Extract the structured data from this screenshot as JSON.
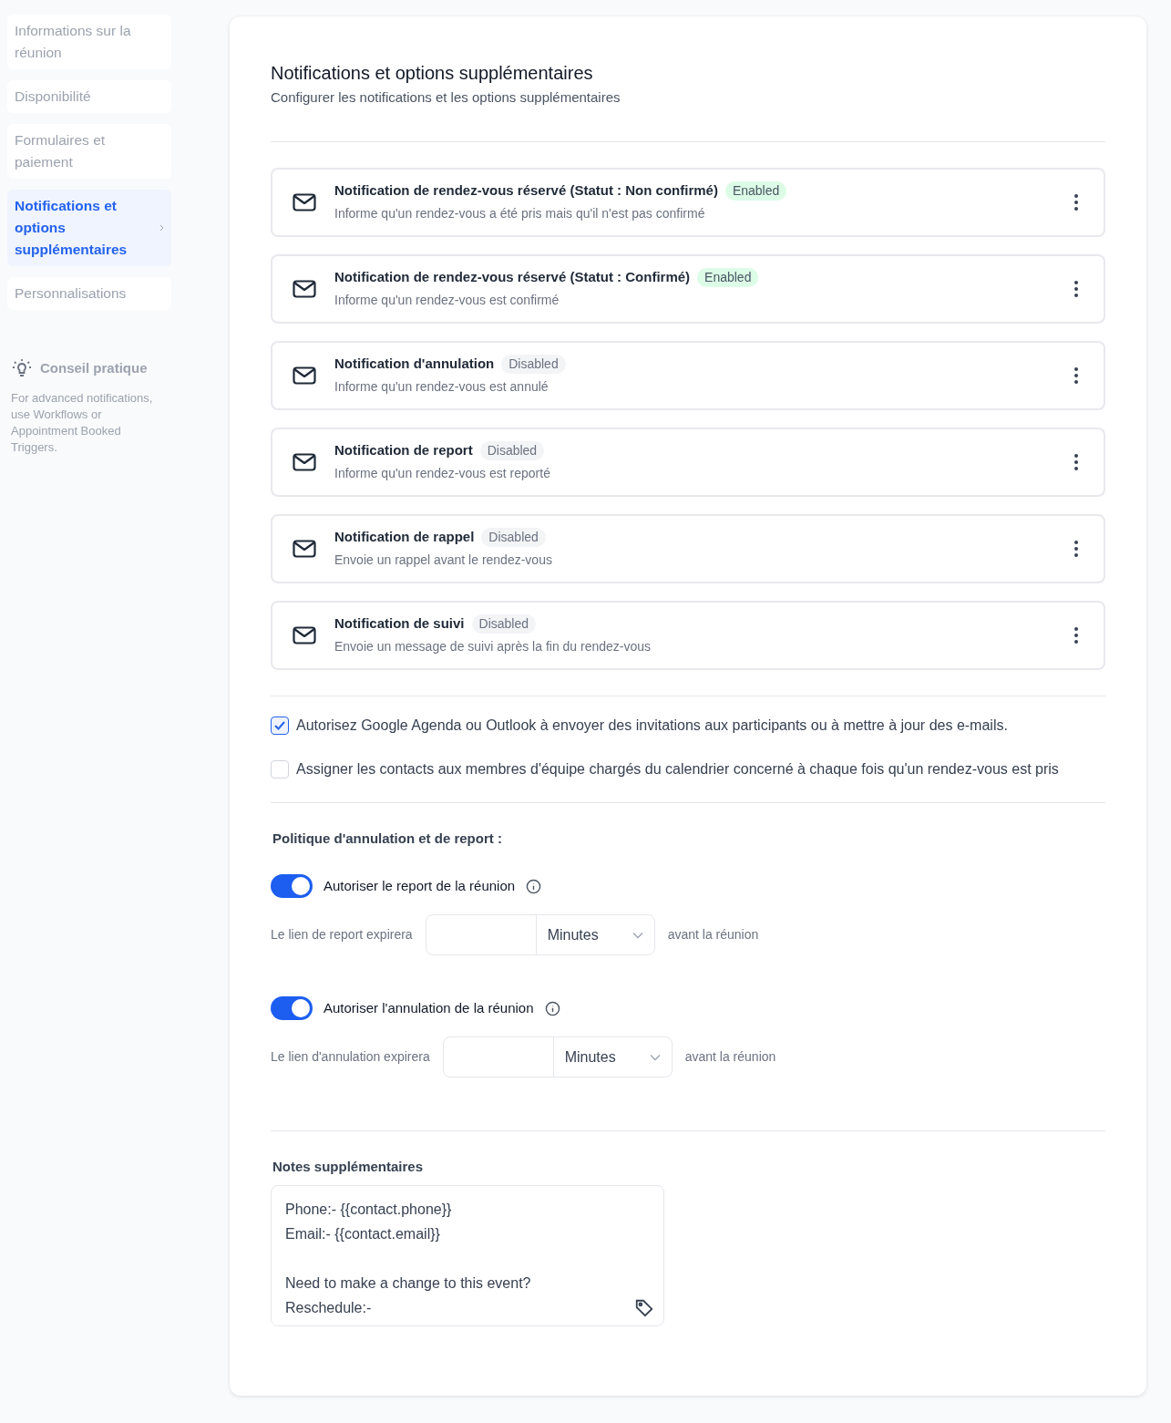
{
  "sidebar": {
    "items": [
      {
        "label": "Informations sur la réunion",
        "selected": false
      },
      {
        "label": "Disponibilité",
        "selected": false
      },
      {
        "label": "Formulaires et paiement",
        "selected": false
      },
      {
        "label": "Notifications et options supplémentaires",
        "selected": true
      },
      {
        "label": "Personnalisations",
        "selected": false
      }
    ],
    "tip": {
      "title": "Conseil pratique",
      "text": "For advanced notifications, use Workflows or Appointment Booked Triggers."
    }
  },
  "header": {
    "title": "Notifications et options supplémentaires",
    "subtitle": "Configurer les notifications et les options supplémentaires"
  },
  "notifications": [
    {
      "title": "Notification de rendez-vous réservé (Statut : Non confirmé)",
      "status": "Enabled",
      "enabled": true,
      "description": "Informe qu'un rendez-vous a été pris mais qu'il n'est pas confirmé"
    },
    {
      "title": "Notification de rendez-vous réservé (Statut : Confirmé)",
      "status": "Enabled",
      "enabled": true,
      "description": "Informe qu'un rendez-vous est confirmé"
    },
    {
      "title": "Notification d'annulation",
      "status": "Disabled",
      "enabled": false,
      "description": "Informe qu'un rendez-vous est annulé"
    },
    {
      "title": "Notification de report",
      "status": "Disabled",
      "enabled": false,
      "description": "Informe qu'un rendez-vous est reporté"
    },
    {
      "title": "Notification de rappel",
      "status": "Disabled",
      "enabled": false,
      "description": "Envoie un rappel avant le rendez-vous"
    },
    {
      "title": "Notification de suivi",
      "status": "Disabled",
      "enabled": false,
      "description": "Envoie un message de suivi après la fin du rendez-vous"
    }
  ],
  "checkboxes": [
    {
      "label": "Autorisez Google Agenda ou Outlook à envoyer des invitations aux participants ou à mettre à jour des e-mails.",
      "checked": true
    },
    {
      "label": "Assigner les contacts aux membres d'équipe chargés du calendrier concerné à chaque fois qu'un rendez-vous est pris",
      "checked": false
    }
  ],
  "policy": {
    "title": "Politique d'annulation et de report :",
    "options": [
      {
        "label": "Autoriser le report de la réunion",
        "on": true,
        "expiry_label": "Le lien de report expirera",
        "unit": "Minutes",
        "suffix": "avant la réunion"
      },
      {
        "label": "Autoriser l'annulation de la réunion",
        "on": true,
        "expiry_label": "Le lien d'annulation expirera",
        "unit": "Minutes",
        "suffix": "avant la réunion"
      }
    ]
  },
  "notes": {
    "title": "Notes supplémentaires",
    "paragraphs": [
      [
        "Phone:- {{contact.phone}}",
        "Email:- {{contact.email}}"
      ],
      [
        "Need to make a change to this event?",
        "Reschedule:-"
      ]
    ]
  }
}
